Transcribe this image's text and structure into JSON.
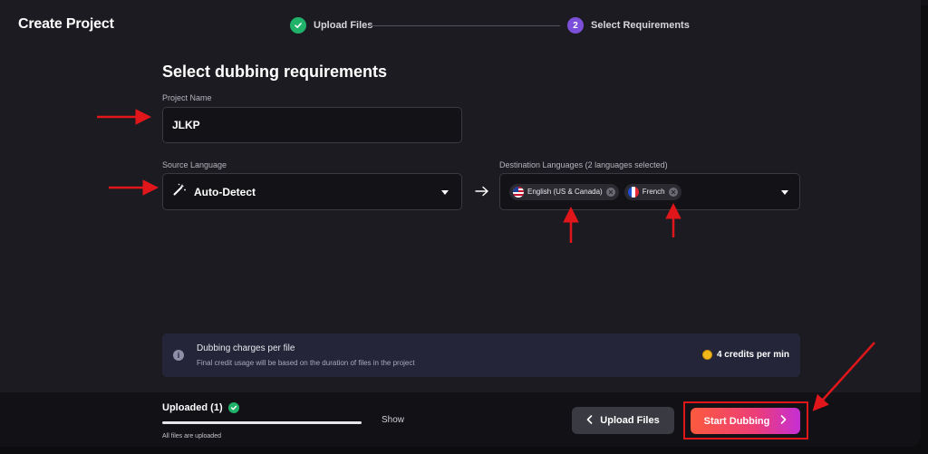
{
  "header": {
    "title": "Create Project"
  },
  "steps": [
    {
      "label": "Upload Files",
      "status": "done"
    },
    {
      "number": "2",
      "label": "Select Requirements",
      "status": "active"
    }
  ],
  "form": {
    "section_title": "Select dubbing requirements",
    "project_name_label": "Project Name",
    "project_name_value": "JLKP",
    "source_label": "Source Language",
    "source_value": "Auto-Detect",
    "dest_label": "Destination Languages (2 languages selected)",
    "dest_chips": [
      {
        "label": "English (US & Canada)",
        "flag": "us"
      },
      {
        "label": "French",
        "flag": "fr"
      }
    ]
  },
  "info": {
    "title": "Dubbing charges per file",
    "subtitle": "Final credit usage will be based on the duration of files in the project",
    "credits": "4 credits per min"
  },
  "footer": {
    "uploaded_label": "Uploaded (1)",
    "show_label": "Show",
    "all_uploaded": "All files are uploaded",
    "upload_progress": 1.0,
    "upload_files_label": "Upload Files",
    "start_dubbing_label": "Start Dubbing"
  },
  "colors": {
    "accent_purple": "#7b4fd9",
    "success_green": "#21b26a",
    "annotation_red": "#e0161b"
  }
}
